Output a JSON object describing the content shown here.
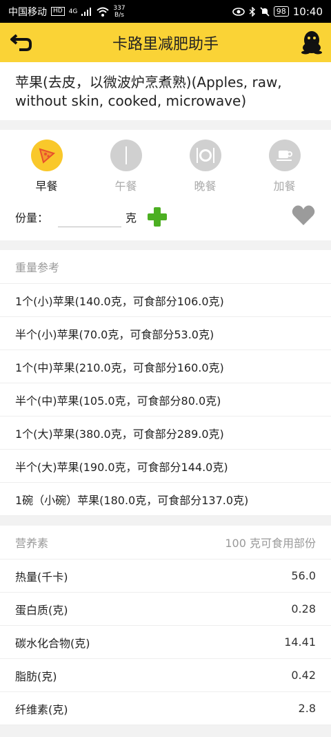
{
  "status": {
    "carrier": "中国移动",
    "hd": "HD",
    "net": "4G",
    "speed_top": "337",
    "speed_bottom": "B/s",
    "battery": "98",
    "time": "10:40"
  },
  "appbar": {
    "title": "卡路里减肥助手"
  },
  "food": {
    "name": "苹果(去皮，以微波炉烹煮熟)(Apples, raw, without skin, cooked, microwave)"
  },
  "meals": [
    {
      "label": "早餐",
      "icon": "pizza-icon",
      "active": true
    },
    {
      "label": "午餐",
      "icon": "utensil-icon",
      "active": false
    },
    {
      "label": "晚餐",
      "icon": "plate-icon",
      "active": false
    },
    {
      "label": "加餐",
      "icon": "coffee-icon",
      "active": false
    }
  ],
  "portion": {
    "label": "份量：",
    "value": "",
    "unit": "克"
  },
  "weights": {
    "header": "重量参考",
    "items": [
      "1个(小)苹果(140.0克，可食部分106.0克)",
      "半个(小)苹果(70.0克，可食部分53.0克)",
      "1个(中)苹果(210.0克，可食部分160.0克)",
      "半个(中)苹果(105.0克，可食部分80.0克)",
      "1个(大)苹果(380.0克，可食部分289.0克)",
      "半个(大)苹果(190.0克，可食部分144.0克)",
      "1碗（小碗）苹果(180.0克，可食部分137.0克)"
    ]
  },
  "nutrients": {
    "header": "营养素",
    "header_right": "100 克可食用部份",
    "items": [
      {
        "name": "热量(千卡)",
        "value": "56.0"
      },
      {
        "name": "蛋白质(克)",
        "value": "0.28"
      },
      {
        "name": "碳水化合物(克)",
        "value": "14.41"
      },
      {
        "name": "脂肪(克)",
        "value": "0.42"
      },
      {
        "name": "纤维素(克)",
        "value": "2.8"
      }
    ]
  },
  "colors": {
    "accent": "#fad336",
    "plus": "#4caf22",
    "inactive": "#d0d0d0"
  }
}
